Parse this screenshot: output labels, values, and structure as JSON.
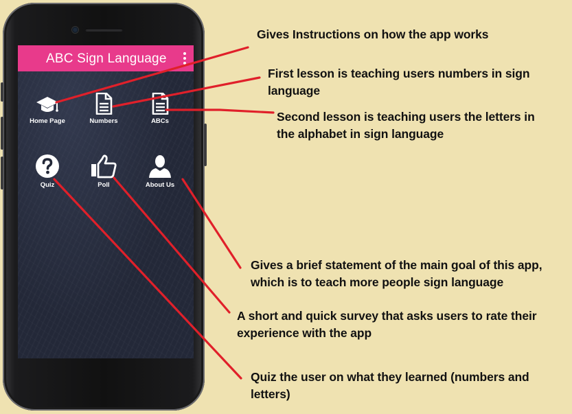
{
  "app": {
    "title": "ABC Sign Language",
    "menu_icon": "more-vertical-icon",
    "brand_color": "#e83a8b"
  },
  "tiles": [
    {
      "label": "Home Page",
      "icon": "graduation-cap-icon"
    },
    {
      "label": "Numbers",
      "icon": "document-icon"
    },
    {
      "label": "ABCs",
      "icon": "document-icon"
    },
    {
      "label": "Quiz",
      "icon": "question-circle-icon"
    },
    {
      "label": "Poll",
      "icon": "thumbs-up-icon"
    },
    {
      "label": "About Us",
      "icon": "user-icon"
    }
  ],
  "annotations": {
    "home": {
      "line1": "Gives Instructions on how the app works"
    },
    "numbers": {
      "line1": "First lesson is teaching users numbers in sign",
      "line2": "language"
    },
    "abcs": {
      "line1": "Second lesson is teaching users the letters in",
      "line2": "the alphabet in sign language"
    },
    "about": {
      "line1": "Gives a brief statement of the main goal of this app,",
      "line2": "which is to teach more people sign language"
    },
    "poll": {
      "line1": "A short and quick survey that asks users to rate their",
      "line2": "experience with the app"
    },
    "quiz": {
      "line1": "Quiz the user on what they learned (numbers and",
      "line2": "letters)"
    }
  },
  "colors": {
    "background": "#efe2b1",
    "arrow": "#e0202a",
    "screen": "#232838"
  }
}
